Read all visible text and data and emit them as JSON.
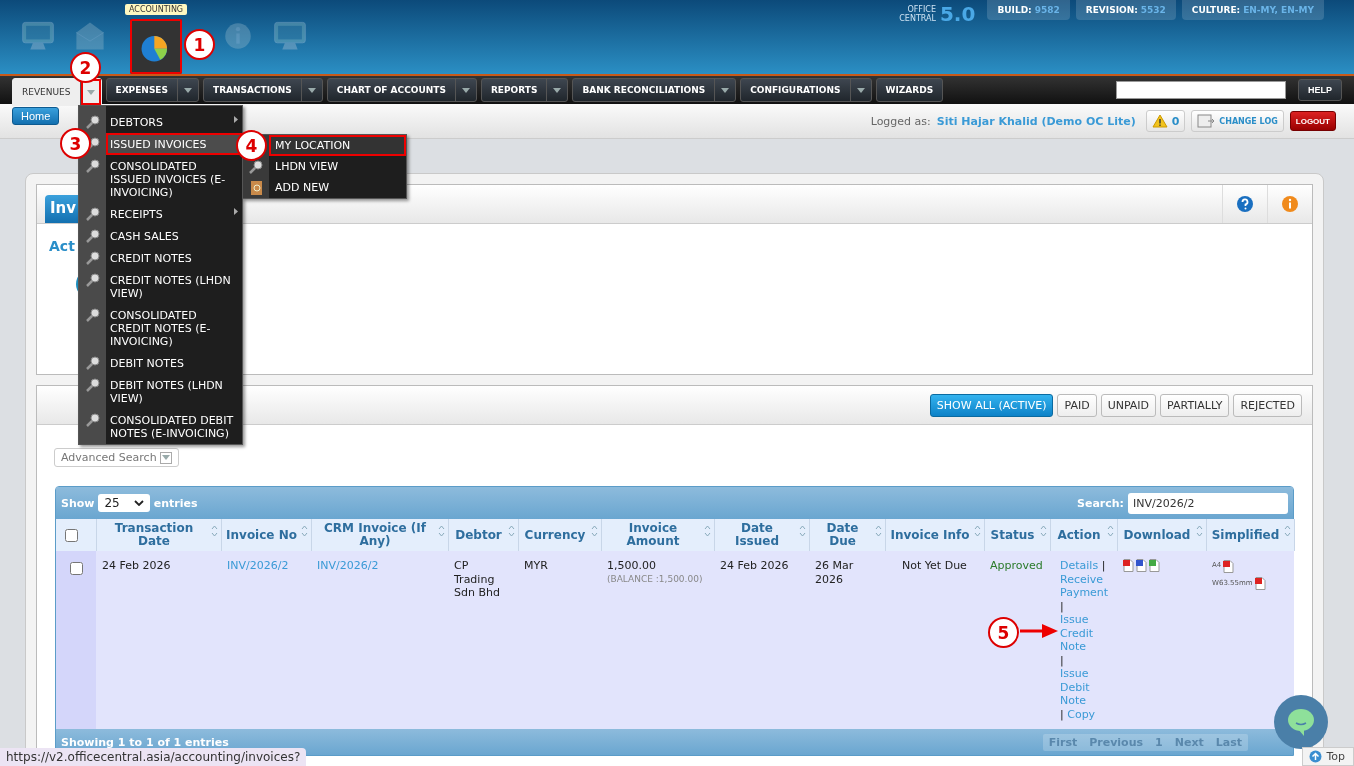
{
  "header": {
    "apps": [
      {
        "kind": "monitor",
        "selected": false,
        "highlighted": false
      },
      {
        "kind": "envelope",
        "selected": false,
        "highlighted": false
      },
      {
        "kind": "pie",
        "selected": true,
        "highlighted": true,
        "tooltip": "ACCOUNTING"
      },
      {
        "kind": "info",
        "selected": false,
        "highlighted": false
      },
      {
        "kind": "monitor",
        "selected": false,
        "highlighted": false
      }
    ],
    "product": {
      "line_1": "OFFICE",
      "line_2": "CENTRAL",
      "version": "5.0"
    },
    "badges": [
      {
        "label": "BUILD:",
        "value": "9582"
      },
      {
        "label": "REVISION:",
        "value": "5532"
      },
      {
        "label": "CULTURE:",
        "value": "EN-MY, EN-MY"
      }
    ]
  },
  "nav": {
    "tabs": [
      {
        "label": "REVENUES",
        "selected": true,
        "dropdown": true,
        "highlighted": true
      },
      {
        "label": "EXPENSES",
        "selected": false,
        "dropdown": true,
        "highlighted": false
      },
      {
        "label": "TRANSACTIONS",
        "selected": false,
        "dropdown": true,
        "highlighted": false
      },
      {
        "label": "CHART OF ACCOUNTS",
        "selected": false,
        "dropdown": true,
        "highlighted": false
      },
      {
        "label": "REPORTS",
        "selected": false,
        "dropdown": true,
        "highlighted": false
      },
      {
        "label": "BANK RECONCILIATIONS",
        "selected": false,
        "dropdown": true,
        "highlighted": false
      },
      {
        "label": "CONFIGURATIONS",
        "selected": false,
        "dropdown": true,
        "highlighted": false
      },
      {
        "label": "WIZARDS",
        "selected": false,
        "dropdown": false,
        "highlighted": false
      }
    ],
    "help": "HELP"
  },
  "subbar": {
    "home": "Home",
    "logged_label": "Logged as:",
    "user": "Siti Hajar Khalid (Demo OC Lite)",
    "alerts": "0",
    "change_log": "CHANGE LOG",
    "logout": "LOGOUT"
  },
  "menu": {
    "items": [
      {
        "label": "DEBTORS",
        "has_submenu": true,
        "selected": false,
        "highlighted": false
      },
      {
        "label": "ISSUED INVOICES",
        "has_submenu": false,
        "selected": true,
        "highlighted": true
      },
      {
        "label": "CONSOLIDATED ISSUED INVOICES (E-INVOICING)",
        "has_submenu": false,
        "selected": false,
        "highlighted": false
      },
      {
        "label": "RECEIPTS",
        "has_submenu": true,
        "selected": false,
        "highlighted": false
      },
      {
        "label": "CASH SALES",
        "has_submenu": false,
        "selected": false,
        "highlighted": false
      },
      {
        "label": "CREDIT NOTES",
        "has_submenu": false,
        "selected": false,
        "highlighted": false
      },
      {
        "label": "CREDIT NOTES (LHDN VIEW)",
        "has_submenu": false,
        "selected": false,
        "highlighted": false
      },
      {
        "label": "CONSOLIDATED CREDIT NOTES (E-INVOICING)",
        "has_submenu": false,
        "selected": false,
        "highlighted": false
      },
      {
        "label": "DEBIT NOTES",
        "has_submenu": false,
        "selected": false,
        "highlighted": false
      },
      {
        "label": "DEBIT NOTES (LHDN VIEW)",
        "has_submenu": false,
        "selected": false,
        "highlighted": false
      },
      {
        "label": "CONSOLIDATED DEBIT NOTES (E-INVOICING)",
        "has_submenu": false,
        "selected": false,
        "highlighted": false
      }
    ],
    "submenu": [
      {
        "label": "MY LOCATION",
        "kind": "plain",
        "selected": true,
        "highlighted": true
      },
      {
        "label": "LHDN VIEW",
        "kind": "search",
        "selected": false,
        "highlighted": false
      },
      {
        "label": "ADD NEW",
        "kind": "add",
        "selected": false,
        "highlighted": false
      }
    ]
  },
  "panel": {
    "title": "Inv",
    "section": "Act"
  },
  "filters": [
    {
      "label": "SHOW ALL (ACTIVE)",
      "selected": true
    },
    {
      "label": "PAID",
      "selected": false
    },
    {
      "label": "UNPAID",
      "selected": false
    },
    {
      "label": "PARTIALLY",
      "selected": false
    },
    {
      "label": "REJECTED",
      "selected": false
    }
  ],
  "advanced_search": "Advanced Search",
  "table": {
    "show_label": "Show",
    "page_size": "25",
    "entries_label": "entries",
    "search_label": "Search:",
    "search_value": "INV/2026/2",
    "select_all": false,
    "columns": [
      "Transaction Date",
      "Invoice No",
      "CRM Invoice (If Any)",
      "Debtor",
      "Currency",
      "Invoice Amount",
      "Date Issued",
      "Date Due",
      "Invoice Info",
      "Status",
      "Action",
      "Download",
      "Simplified"
    ],
    "rows": [
      {
        "checked": false,
        "transaction_date": "24 Feb 2026",
        "invoice_no": "INV/2026/2",
        "crm_invoice": "INV/2026/2",
        "debtor": "CP Trading Sdn Bhd",
        "currency": "MYR",
        "amount": "1,500.00",
        "balance": "(BALANCE :1,500.00)",
        "date_issued": "24 Feb 2026",
        "date_due": "26 Mar 2026",
        "invoice_info": "Not Yet Due",
        "status": "Approved",
        "actions": [
          {
            "label": "Details",
            "separator": "|"
          },
          {
            "label": "Receive Payment",
            "separator": "|"
          },
          {
            "label": "Issue Credit Note",
            "separator": "|"
          },
          {
            "label": "Issue Debit Note",
            "separator": "|"
          },
          {
            "label": "Copy"
          }
        ],
        "downloads": [
          {
            "kind": "pdf"
          },
          {
            "kind": "word"
          },
          {
            "kind": "excel"
          }
        ],
        "simplified": [
          {
            "label": "A4"
          },
          {
            "label": "W63.55mm"
          }
        ]
      }
    ],
    "footer": "Showing 1 to 1 of 1 entries",
    "pagination": [
      "First",
      "Previous",
      "1",
      "Next",
      "Last"
    ]
  },
  "annotations": [
    {
      "number": "1"
    },
    {
      "number": "2"
    },
    {
      "number": "3"
    },
    {
      "number": "4"
    },
    {
      "number": "5"
    }
  ],
  "status_url": "https://v2.officecentral.asia/accounting/invoices?",
  "top_button": "Top"
}
